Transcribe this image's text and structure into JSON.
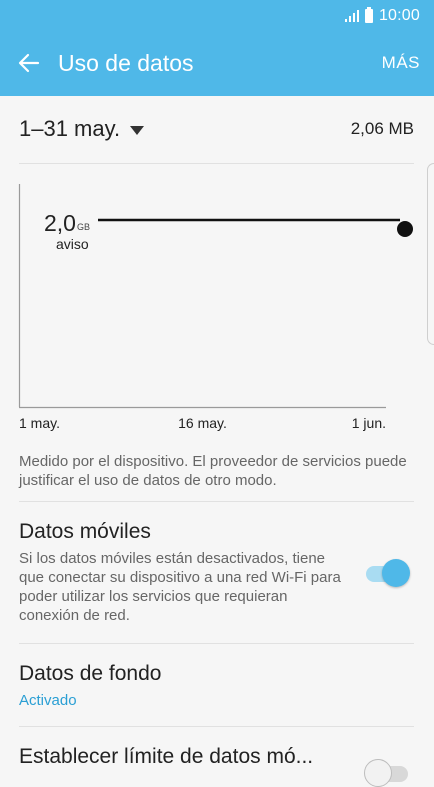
{
  "status_bar": {
    "time": "10:00"
  },
  "app_bar": {
    "title": "Uso de datos",
    "more_label": "MÁS",
    "back_icon": "arrow-left-icon"
  },
  "period": {
    "label": "1–31 may.",
    "usage": "2,06 MB"
  },
  "chart_data": {
    "type": "line",
    "x_tick_labels": [
      "1 may.",
      "16 may.",
      "1 jun."
    ],
    "warning": {
      "value": "2,0",
      "unit": "GB",
      "label": "aviso"
    }
  },
  "description": "Medido por el dispositivo. El proveedor de servicios puede justificar el uso de datos de otro modo.",
  "mobile_data": {
    "title": "Datos móviles",
    "body": "Si los datos móviles están desactivados, tiene que conectar su dispositivo a una red Wi-Fi para poder utilizar los servicios que requieran conexión de red.",
    "enabled": true
  },
  "background_data": {
    "title": "Datos de fondo",
    "status": "Activado"
  },
  "limit": {
    "title": "Establecer límite de datos mó...",
    "enabled": false
  },
  "colors": {
    "accent": "#4fb8e8",
    "link": "#2a9fd4"
  }
}
